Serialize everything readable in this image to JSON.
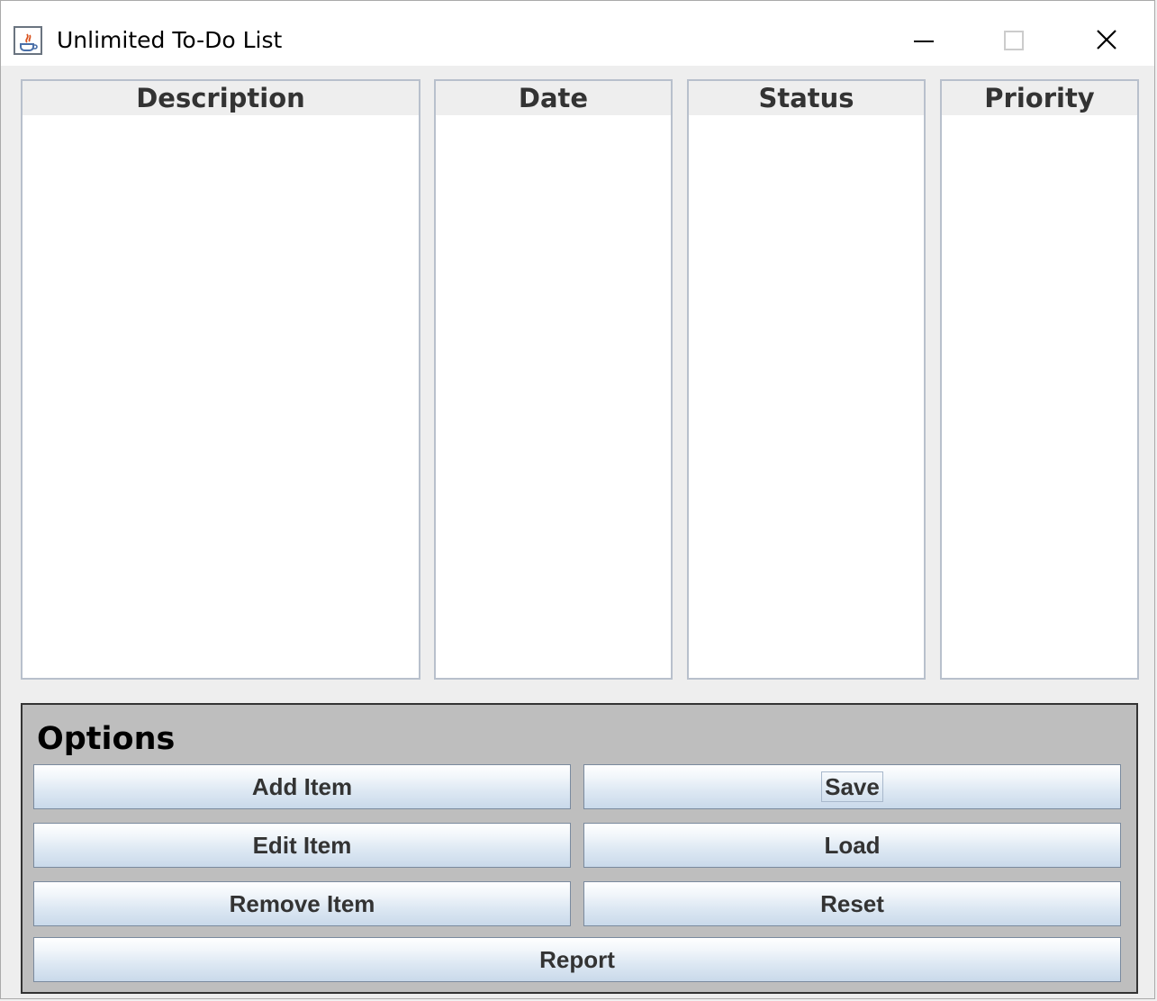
{
  "window": {
    "title": "Unlimited To-Do List",
    "icon": "java-cup-icon",
    "controls": [
      "minimize-icon",
      "maximize-icon",
      "close-icon"
    ]
  },
  "columns": [
    {
      "header": "Description"
    },
    {
      "header": "Date"
    },
    {
      "header": "Status"
    },
    {
      "header": "Priority"
    }
  ],
  "options": {
    "title": "Options",
    "buttons": {
      "add_item": "Add Item",
      "save": "Save",
      "edit_item": "Edit Item",
      "load": "Load",
      "remove_item": "Remove Item",
      "reset": "Reset",
      "report": "Report"
    }
  },
  "colors": {
    "panel_background": "#bebebe",
    "list_border": "#b8c0cc",
    "button_gradient_bottom": "#c9d9ea"
  }
}
